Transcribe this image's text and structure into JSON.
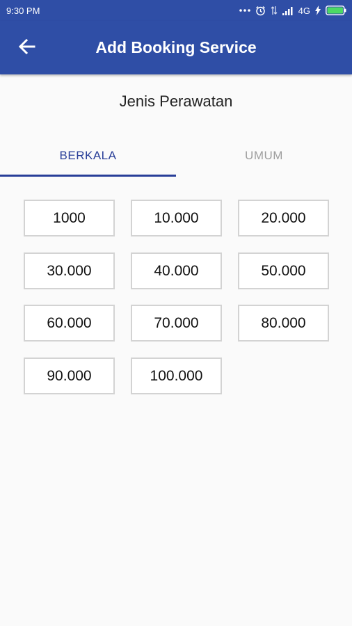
{
  "status_bar": {
    "time": "9:30 PM",
    "network": "4G",
    "icons": [
      "more-dots-icon",
      "alarm-icon",
      "data-transfer-icon",
      "signal-icon",
      "charging-icon",
      "battery-icon"
    ]
  },
  "app_bar": {
    "title": "Add Booking Service",
    "back_icon": "arrow-left-icon",
    "background": "#2f4ea6"
  },
  "section": {
    "title": "Jenis Perawatan"
  },
  "tabs": [
    {
      "label": "BERKALA",
      "selected": true
    },
    {
      "label": "UMUM",
      "selected": false
    }
  ],
  "colors": {
    "accent": "#283e98",
    "inactive_tab": "#9e9e9e"
  },
  "price_options": [
    "1000",
    "10.000",
    "20.000",
    "30.000",
    "40.000",
    "50.000",
    "60.000",
    "70.000",
    "80.000",
    "90.000",
    "100.000"
  ]
}
